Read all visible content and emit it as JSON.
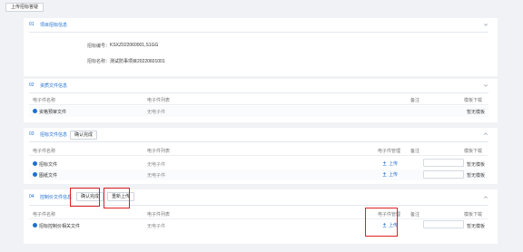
{
  "top_button": "上传招标答疑",
  "sections": [
    {
      "num": "01",
      "title": "项目招标信息",
      "fields": [
        {
          "label": "招标编号：",
          "value": "KSXZ022060001,S1GG"
        },
        {
          "label": "招标名称：",
          "value": "测试防事项目20220601001"
        }
      ]
    },
    {
      "num": "02",
      "title": "资质文件信息",
      "headers": {
        "name": "电子件名称",
        "list": "电子件列表",
        "note": "备注",
        "template": "模板下载"
      },
      "rows": [
        {
          "name": "资格预审文件",
          "list": "无电子件",
          "template": "暂无模板"
        }
      ]
    },
    {
      "num": "03",
      "title": "招标文件信息",
      "button": "确认完成",
      "headers": {
        "name": "电子件名称",
        "list": "电子件列表",
        "manage": "电子件管理",
        "note": "备注",
        "template": "模板下载"
      },
      "rows": [
        {
          "name": "招标文件",
          "list": "无电子件",
          "upload": "上传",
          "template": "暂无模板"
        },
        {
          "name": "图纸文件",
          "list": "无电子件",
          "upload": "上传",
          "template": "暂无模板"
        }
      ]
    },
    {
      "num": "04",
      "title": "控制价文件信息",
      "button": "确认完成",
      "button2": "重新上传",
      "headers": {
        "name": "电子件名称",
        "list": "电子件列表",
        "manage": "电子件管理",
        "note": "备注",
        "template": "模板下载"
      },
      "rows": [
        {
          "name": "招标控制价相关文件",
          "list": "无电子件",
          "upload": "上传",
          "template": "暂无模板"
        }
      ]
    }
  ],
  "colors": {
    "accent": "#1f6fd1",
    "highlight": "#e02020"
  }
}
